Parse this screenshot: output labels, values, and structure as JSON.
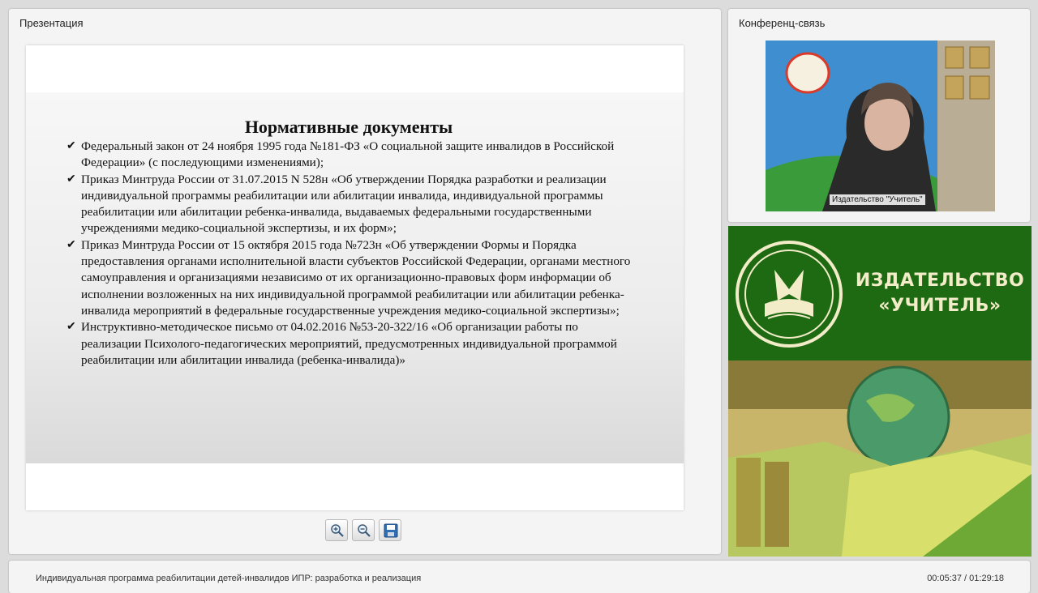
{
  "presentation": {
    "title": "Презентация",
    "slide": {
      "heading": "Нормативные документы",
      "items": [
        "Федеральный закон от 24 ноября 1995 года №181-ФЗ «О социальной защите инвалидов в Российской Федерации» (с последующими изменениями);",
        "Приказ Минтруда России от 31.07.2015 N 528н «Об утверждении Порядка разработки и реализации индивидуальной программы реабилитации или абилитации инвалида, индивидуальной программы реабилитации или абилитации ребенка-инвалида, выдаваемых федеральными государственными учреждениями медико-социальной экспертизы, и их форм»;",
        "Приказ Минтруда России от 15 октября 2015 года №723н «Об утверждении Формы и Порядка предоставления органами исполнительной власти субъектов Российской Федерации, органами местного самоуправления и организациями независимо от их организационно-правовых форм информации об исполнении возложенных на них индивидуальной программой реабилитации или абилитации ребенка-инвалида мероприятий в федеральные государственные учреждения медико-социальной экспертизы»;",
        "Инструктивно-методическое письмо от 04.02.2016 №53-20-322/16 «Об организации работы по реализации Психолого-педагогических мероприятий, предусмотренных индивидуальной программой реабилитации или абилитации инвалида (ребенка-инвалида)»"
      ]
    },
    "toolbar": {
      "zoom_in_icon": "zoom-in-icon",
      "zoom_out_icon": "zoom-out-icon",
      "save_icon": "save-icon"
    }
  },
  "conference": {
    "title": "Конференц-связь",
    "video_label": "Издательство \"Учитель\""
  },
  "banner": {
    "name_line1": "ИЗДАТЕЛЬСТВО",
    "name_line2": "«УЧИТЕЛЬ»"
  },
  "status": {
    "course_title": "Индивидуальная программа реабилитации детей-инвалидов ИПР: разработка и реализация",
    "timecode": "00:05:37 / 01:29:18"
  },
  "colors": {
    "banner_green": "#1e6a13",
    "banner_text": "#f3ecc8"
  }
}
